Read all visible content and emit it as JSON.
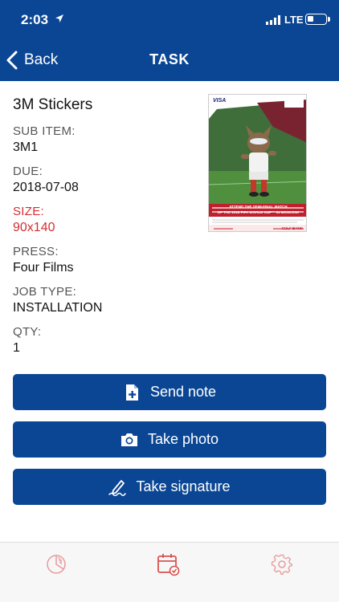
{
  "status_bar": {
    "time": "2:03",
    "network": "LTE",
    "battery_level": 0.35
  },
  "nav": {
    "back_label": "Back",
    "title": "TASK"
  },
  "task": {
    "name": "3M Stickers",
    "fields": [
      {
        "label": "SUB ITEM:",
        "value": "3M1",
        "alert": false
      },
      {
        "label": "DUE:",
        "value": "2018-07-08",
        "alert": false
      },
      {
        "label": "SIZE:",
        "value": "90x140",
        "alert": true
      },
      {
        "label": "PRESS:",
        "value": "Four Films",
        "alert": false
      },
      {
        "label": "JOB TYPE:",
        "value": "INSTALLATION",
        "alert": false
      },
      {
        "label": "QTY:",
        "value": "1",
        "alert": false
      }
    ]
  },
  "thumbnail": {
    "brand": "VISA",
    "headline_1": "ATTEND THE SEMI-FINAL MATCH",
    "headline_2": "OF THE 2018 FIFA WORLD CUP™ IN MOSCOW!",
    "bank": "GULF BANK"
  },
  "actions": {
    "send_note": "Send note",
    "take_photo": "Take photo",
    "take_signature": "Take signature"
  },
  "tabbar": {
    "items": [
      {
        "icon": "pie-chart-icon",
        "active": false
      },
      {
        "icon": "calendar-check-icon",
        "active": true
      },
      {
        "icon": "gear-icon",
        "active": false
      }
    ]
  },
  "colors": {
    "primary": "#0b4694",
    "alert": "#d32f2f",
    "tab_icon": "#d9534f"
  }
}
